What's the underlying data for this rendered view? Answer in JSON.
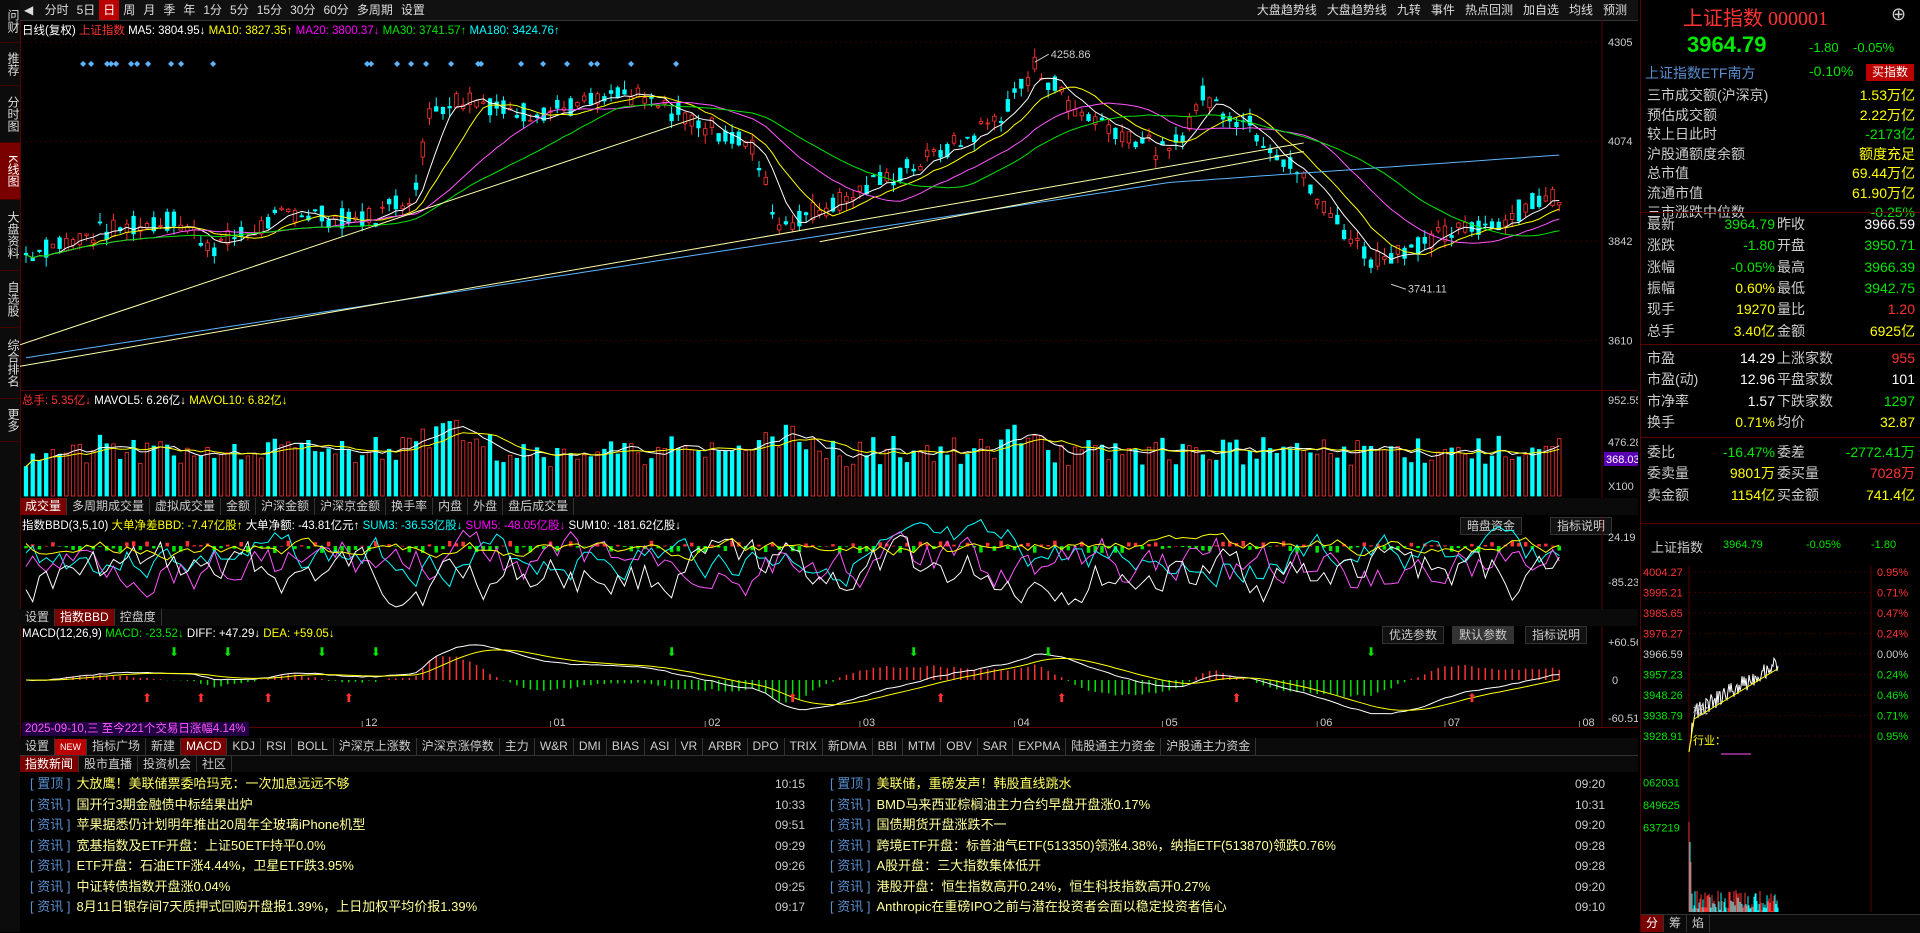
{
  "left_sidebar": [
    {
      "label": "问财"
    },
    {
      "label": "推荐"
    },
    {
      "label": "分时图"
    },
    {
      "label": "K线图",
      "active": true
    },
    {
      "label": "大盘资料"
    },
    {
      "label": "自选股"
    },
    {
      "label": "综合排名"
    },
    {
      "label": "更多"
    }
  ],
  "periods": [
    "分时",
    "5日",
    "日",
    "周",
    "月",
    "季",
    "年",
    "1分",
    "5分",
    "15分",
    "30分",
    "60分",
    "多周期",
    "设置"
  ],
  "top_right": [
    "大盘趋势线",
    "大盘趋势线",
    "九转",
    "事件",
    "热点回测",
    "加自选",
    "均线",
    "预测"
  ],
  "ma_line": {
    "title": "日线(复权)",
    "index": "上证指数",
    "ma5": "MA5: 3804.95↓",
    "ma10": "MA10: 3827.35↑",
    "ma20": "MA20: 3800.37↓",
    "ma30": "MA30: 3741.57↑",
    "ma180": "MA180: 3424.76↑"
  },
  "price_axis": [
    "4305",
    "4074",
    "3842",
    "3610"
  ],
  "annotations": {
    "high": "4258.86",
    "low": "3741.11"
  },
  "vol_line": {
    "total": "总手: 5.35亿↓",
    "mavol5": "MAVOL5: 6.26亿↓",
    "mavol10": "MAVOL10: 6.82亿↓"
  },
  "vol_axis": [
    "952.55万",
    "476.28万",
    "368.03万",
    "X100"
  ],
  "vol_tabs": [
    "成交量",
    "多周期成交量",
    "虚拟成交量",
    "金额",
    "沪深金额",
    "沪深京金额",
    "换手率",
    "内盘",
    "外盘",
    "盘后成交量"
  ],
  "bbd_line": {
    "title": "指数BBD(3,5,10)",
    "big": "大单净差BBD: -7.47亿股↑",
    "amount": "大单净额: -43.81亿元↑",
    "sum3": "SUM3: -36.53亿股↓",
    "sum5": "SUM5: -48.05亿股↓",
    "sum10": "SUM10: -181.62亿股↓"
  },
  "bbd_buttons": [
    "暗盘资金",
    "指标说明"
  ],
  "bbd_axis": [
    "24.19",
    "-85.23"
  ],
  "bbd_tabs": [
    "设置",
    "指数BBD",
    "控盘度"
  ],
  "macd_line": {
    "title": "MACD(12,26,9)",
    "macd": "MACD: -23.52↓",
    "diff": "DIFF: +47.29↓",
    "dea": "DEA: +59.05↓"
  },
  "macd_buttons": [
    "优选参数",
    "默认参数",
    "指标说明"
  ],
  "macd_axis": [
    "+60.56",
    "0",
    "-60.51"
  ],
  "date_axis": [
    "12",
    "01",
    "02",
    "03",
    "04",
    "05",
    "06",
    "07",
    "08"
  ],
  "hover_info": "2025-09-10,三 至今221个交易日涨幅4.14%",
  "indicator_tabs": [
    "设置",
    "NEW",
    "指标广场",
    "新建",
    "MACD",
    "KDJ",
    "RSI",
    "BOLL",
    "沪深京上涨数",
    "沪深京涨停数",
    "主力",
    "W&R",
    "DMI",
    "BIAS",
    "ASI",
    "VR",
    "ARBR",
    "DPO",
    "TRIX",
    "新DMA",
    "BBI",
    "MTM",
    "OBV",
    "SAR",
    "EXPMA",
    "陆股通主力资金",
    "沪股通主力资金"
  ],
  "news_tabs": [
    "指数新闻",
    "股市直播",
    "投资机会",
    "社区"
  ],
  "news_left": [
    {
      "tag": "置顶",
      "text": "大放鹰！美联储票委哈玛克：一次加息远远不够",
      "time": "10:15"
    },
    {
      "tag": "资讯",
      "text": "国开行3期金融债中标结果出炉",
      "time": "10:33"
    },
    {
      "tag": "资讯",
      "text": "苹果据悉仍计划明年推出20周年全玻璃iPhone机型",
      "time": "09:51"
    },
    {
      "tag": "资讯",
      "text": "宽基指数及ETF开盘：上证50ETF持平0.0%",
      "time": "09:29"
    },
    {
      "tag": "资讯",
      "text": "ETF开盘：石油ETF涨4.44%，卫星ETF跌3.95%",
      "time": "09:26"
    },
    {
      "tag": "资讯",
      "text": "中证转债指数开盘涨0.04%",
      "time": "09:25"
    },
    {
      "tag": "资讯",
      "text": "8月11日银存间7天质押式回购开盘报1.39%，上日加权平均价报1.39%",
      "time": "09:17"
    }
  ],
  "news_right": [
    {
      "tag": "置顶",
      "text": "美联储，重磅发声！韩股直线跳水",
      "time": "09:20"
    },
    {
      "tag": "资讯",
      "text": "BMD马来西亚棕榈油主力合约早盘开盘涨0.17%",
      "time": "10:31"
    },
    {
      "tag": "资讯",
      "text": "国债期货开盘涨跌不一",
      "time": "09:20"
    },
    {
      "tag": "资讯",
      "text": "跨境ETF开盘：标普油气ETF(513350)领涨4.38%，纳指ETF(513870)领跌0.76%",
      "time": "09:28"
    },
    {
      "tag": "资讯",
      "text": "A股开盘：三大指数集体低开",
      "time": "09:28"
    },
    {
      "tag": "资讯",
      "text": "港股开盘：恒生指数高开0.24%，恒生科技指数高开0.27%",
      "time": "09:20"
    },
    {
      "tag": "资讯",
      "text": "Anthropic在重磅IPO之前与潜在投资者会面以稳定投资者信心",
      "time": "09:10"
    }
  ],
  "quote": {
    "name": "上证指数 000001",
    "price": "3964.79",
    "change": "-1.80",
    "pct": "-0.05%",
    "etf": "上证指数ETF南方",
    "etf_pct": "-0.10%",
    "buy": "买指数",
    "stats_top": [
      {
        "l": "三市成交额(沪深京)",
        "v": "1.53万亿",
        "c": "#ffff00"
      },
      {
        "l": "预估成交额",
        "v": "2.22万亿",
        "c": "#ffff00"
      },
      {
        "l": "较上日此时",
        "v": "-2173亿",
        "c": "#00e600"
      },
      {
        "l": "沪股通额度余额",
        "v": "额度充足",
        "c": "#ffff00"
      },
      {
        "l": "总市值",
        "v": "69.44万亿",
        "c": "#ffff00"
      },
      {
        "l": "流通市值",
        "v": "61.90万亿",
        "c": "#ffff00"
      },
      {
        "l": "三市涨跌中位数",
        "v": "-0.25%",
        "c": "#00e600"
      }
    ],
    "grid": [
      {
        "l1": "最新",
        "v1": "3964.79",
        "c1": "#00e600",
        "l2": "昨收",
        "v2": "3966.59",
        "c2": "#ffffff"
      },
      {
        "l1": "涨跌",
        "v1": "-1.80",
        "c1": "#00e600",
        "l2": "开盘",
        "v2": "3950.71",
        "c2": "#00e600"
      },
      {
        "l1": "涨幅",
        "v1": "-0.05%",
        "c1": "#00e600",
        "l2": "最高",
        "v2": "3966.39",
        "c2": "#00e600"
      },
      {
        "l1": "振幅",
        "v1": "0.60%",
        "c1": "#ffff00",
        "l2": "最低",
        "v2": "3942.75",
        "c2": "#00e600"
      },
      {
        "l1": "现手",
        "v1": "19270",
        "c1": "#ffff00",
        "l2": "量比",
        "v2": "1.20",
        "c2": "#ff3232"
      },
      {
        "l1": "总手",
        "v1": "3.40亿",
        "c1": "#ffff00",
        "l2": "金额",
        "v2": "6925亿",
        "c2": "#ffff00"
      }
    ],
    "grid2": [
      {
        "l1": "市盈",
        "v1": "14.29",
        "c1": "#ffffff",
        "l2": "上涨家数",
        "v2": "955",
        "c2": "#ff3232"
      },
      {
        "l1": "市盈(动)",
        "v1": "12.96",
        "c1": "#ffffff",
        "l2": "平盘家数",
        "v2": "101",
        "c2": "#ffffff"
      },
      {
        "l1": "市净率",
        "v1": "1.57",
        "c1": "#ffffff",
        "l2": "下跌家数",
        "v2": "1297",
        "c2": "#00e600"
      },
      {
        "l1": "换手",
        "v1": "0.71%",
        "c1": "#ffff00",
        "l2": "均价",
        "v2": "32.87",
        "c2": "#ffff00"
      }
    ],
    "grid3": [
      {
        "l1": "委比",
        "v1": "-16.47%",
        "c1": "#00e600",
        "l2": "委差",
        "v2": "-2772.41万",
        "c2": "#00e600"
      },
      {
        "l1": "委卖量",
        "v1": "9801万",
        "c1": "#ffff00",
        "l2": "委买量",
        "v2": "7028万",
        "c2": "#ff3232"
      },
      {
        "l1": "卖金额",
        "v1": "1154亿",
        "c1": "#ffff00",
        "l2": "买金额",
        "v2": "741.4亿",
        "c2": "#ffff00"
      }
    ]
  },
  "mini_chart": {
    "title": "上证指数",
    "price": "3964.79",
    "pct": "-0.05%",
    "change": "-1.80",
    "left_axis": [
      "4004.27",
      "3995.21",
      "3985.65",
      "3976.27",
      "3966.59",
      "3957.23",
      "3948.26",
      "3938.79",
      "3928.91",
      "062031",
      "849625",
      "637219"
    ],
    "right_axis": [
      "0.95%",
      "0.71%",
      "0.47%",
      "0.24%",
      "0.00%",
      "0.24%",
      "0.46%",
      "0.71%",
      "0.95%"
    ],
    "labels": [
      "概：",
      "行业："
    ],
    "tabs": [
      "分",
      "筹",
      "焰"
    ]
  }
}
